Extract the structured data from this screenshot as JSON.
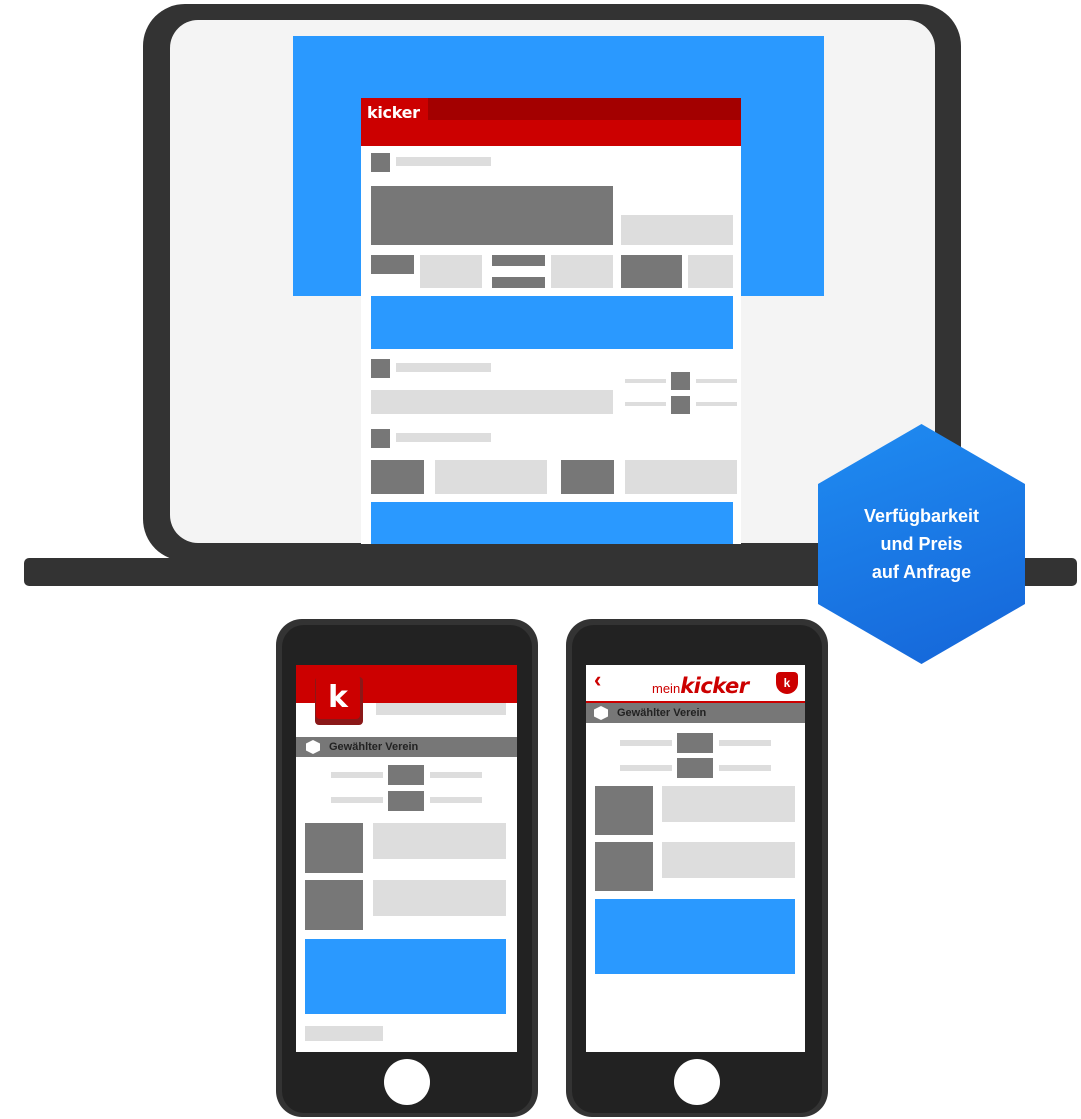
{
  "site": {
    "logo": "kicker"
  },
  "badge": {
    "line1": "Verfügbarkeit",
    "line2": "und Preis",
    "line3": "auf Anfrage"
  },
  "phone_left": {
    "logo_letter": "k",
    "club_label": "Gewählter Verein"
  },
  "phone_right": {
    "back_icon": "chevron-left-icon",
    "title_prefix": "mein",
    "title_brand": "kicker",
    "club_label": "Gewählter Verein",
    "shield_letter": "k"
  },
  "colors": {
    "brand_red": "#cc0000",
    "accent_blue": "#2a99ff",
    "device_frame": "#333333",
    "placeholder_dark": "#777777",
    "placeholder_light": "#dddddd"
  }
}
